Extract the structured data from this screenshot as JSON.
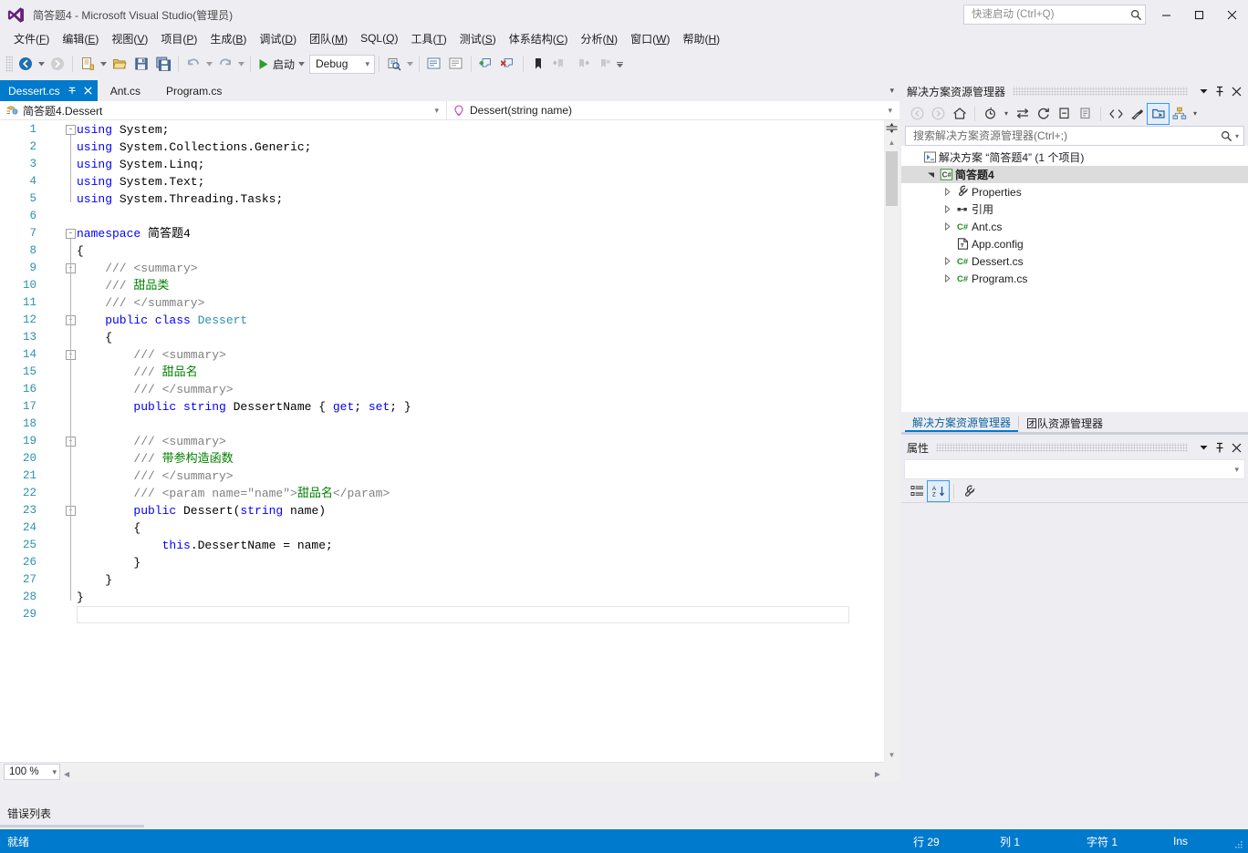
{
  "window": {
    "title": "简答题4 - Microsoft Visual Studio(管理员)",
    "logo_icon": "visual-studio-logo",
    "minimize_label": "–",
    "maximize_label": "❐",
    "close_label": "✕"
  },
  "quick_launch": {
    "placeholder": "快速启动 (Ctrl+Q)",
    "value": "",
    "icon": "search-icon"
  },
  "menu": {
    "items": [
      {
        "label": "文件",
        "key": "F"
      },
      {
        "label": "编辑",
        "key": "E"
      },
      {
        "label": "视图",
        "key": "V"
      },
      {
        "label": "项目",
        "key": "P"
      },
      {
        "label": "生成",
        "key": "B"
      },
      {
        "label": "调试",
        "key": "D"
      },
      {
        "label": "团队",
        "key": "M"
      },
      {
        "label": "SQL",
        "key": "Q"
      },
      {
        "label": "工具",
        "key": "T"
      },
      {
        "label": "测试",
        "key": "S"
      },
      {
        "label": "体系结构",
        "key": "C"
      },
      {
        "label": "分析",
        "key": "N"
      },
      {
        "label": "窗口",
        "key": "W"
      },
      {
        "label": "帮助",
        "key": "H"
      }
    ]
  },
  "toolbar": {
    "navigate_back_icon": "navigate-back-icon",
    "navigate_forward_icon": "navigate-forward-icon",
    "new_project_icon": "new-project-icon",
    "open_file_icon": "open-file-icon",
    "save_icon": "save-icon",
    "save_all_icon": "save-all-icon",
    "undo_icon": "undo-icon",
    "redo_icon": "redo-icon",
    "start_label": "启动",
    "start_icon": "play-icon",
    "config_value": "Debug",
    "find_icon": "find-in-files-icon",
    "comment_icon": "comment-icon",
    "uncomment_icon": "uncomment-icon",
    "outdent_icon": "outdent-icon",
    "indent_icon": "indent-icon",
    "bookmark_add_icon": "add-bookmark-icon",
    "bookmark_remove_icon": "remove-bookmark-icon",
    "bookmark_icon": "bookmark-icon",
    "prev_bookmark_icon": "previous-bookmark-icon",
    "next_bookmark_icon": "next-bookmark-icon",
    "clear_bookmarks_icon": "clear-bookmarks-icon",
    "overflow_icon": "toolbar-overflow-icon"
  },
  "doc_tabs": [
    {
      "label": "Dessert.cs",
      "active": true,
      "pin_icon": "pin-icon",
      "close_icon": "close-icon"
    },
    {
      "label": "Ant.cs",
      "active": false
    },
    {
      "label": "Program.cs",
      "active": false
    }
  ],
  "nav_bar": {
    "type_icon": "class-member-icon",
    "type_value": "简答题4.Dessert",
    "member_icon": "method-icon",
    "member_value": "Dessert(string name)"
  },
  "editor": {
    "zoom_level": "100 %",
    "caret_line": 29,
    "total_lines": 29,
    "lines": [
      {
        "n": 1,
        "fold": "-",
        "indent": 0,
        "tokens": [
          {
            "t": "using",
            "c": "kw"
          },
          {
            "t": " System;",
            "c": ""
          }
        ]
      },
      {
        "n": 2,
        "fold": "",
        "indent": 0,
        "tokens": [
          {
            "t": "using",
            "c": "kw"
          },
          {
            "t": " System.Collections.Generic;",
            "c": ""
          }
        ]
      },
      {
        "n": 3,
        "fold": "",
        "indent": 0,
        "tokens": [
          {
            "t": "using",
            "c": "kw"
          },
          {
            "t": " System.Linq;",
            "c": ""
          }
        ]
      },
      {
        "n": 4,
        "fold": "",
        "indent": 0,
        "tokens": [
          {
            "t": "using",
            "c": "kw"
          },
          {
            "t": " System.Text;",
            "c": ""
          }
        ]
      },
      {
        "n": 5,
        "fold": "",
        "indent": 0,
        "tokens": [
          {
            "t": "using",
            "c": "kw"
          },
          {
            "t": " System.Threading.Tasks;",
            "c": ""
          }
        ]
      },
      {
        "n": 6,
        "fold": "",
        "indent": 0,
        "tokens": []
      },
      {
        "n": 7,
        "fold": "-",
        "indent": 0,
        "tokens": [
          {
            "t": "namespace",
            "c": "kw"
          },
          {
            "t": " 简答题4",
            "c": ""
          }
        ]
      },
      {
        "n": 8,
        "fold": "",
        "indent": 0,
        "tokens": [
          {
            "t": "{",
            "c": ""
          }
        ]
      },
      {
        "n": 9,
        "fold": "-",
        "indent": 1,
        "tokens": [
          {
            "t": "/// <summary>",
            "c": "cmt"
          }
        ]
      },
      {
        "n": 10,
        "fold": "",
        "indent": 1,
        "tokens": [
          {
            "t": "/// ",
            "c": "cmt"
          },
          {
            "t": "甜品类",
            "c": "cmz"
          }
        ]
      },
      {
        "n": 11,
        "fold": "",
        "indent": 1,
        "tokens": [
          {
            "t": "/// </summary>",
            "c": "cmt"
          }
        ]
      },
      {
        "n": 12,
        "fold": "-",
        "indent": 1,
        "tokens": [
          {
            "t": "public class ",
            "c": "kw"
          },
          {
            "t": "Dessert",
            "c": "typ"
          }
        ]
      },
      {
        "n": 13,
        "fold": "",
        "indent": 1,
        "tokens": [
          {
            "t": "{",
            "c": ""
          }
        ]
      },
      {
        "n": 14,
        "fold": "-",
        "indent": 2,
        "tokens": [
          {
            "t": "/// <summary>",
            "c": "cmt"
          }
        ]
      },
      {
        "n": 15,
        "fold": "",
        "indent": 2,
        "tokens": [
          {
            "t": "/// ",
            "c": "cmt"
          },
          {
            "t": "甜品名",
            "c": "cmz"
          }
        ]
      },
      {
        "n": 16,
        "fold": "",
        "indent": 2,
        "tokens": [
          {
            "t": "/// </summary>",
            "c": "cmt"
          }
        ]
      },
      {
        "n": 17,
        "fold": "",
        "indent": 2,
        "tokens": [
          {
            "t": "public string",
            "c": "kw"
          },
          {
            "t": " DessertName { ",
            "c": ""
          },
          {
            "t": "get",
            "c": "kw"
          },
          {
            "t": "; ",
            "c": ""
          },
          {
            "t": "set",
            "c": "kw"
          },
          {
            "t": "; }",
            "c": ""
          }
        ]
      },
      {
        "n": 18,
        "fold": "",
        "indent": 2,
        "tokens": []
      },
      {
        "n": 19,
        "fold": "-",
        "indent": 2,
        "tokens": [
          {
            "t": "/// <summary>",
            "c": "cmt"
          }
        ]
      },
      {
        "n": 20,
        "fold": "",
        "indent": 2,
        "tokens": [
          {
            "t": "/// ",
            "c": "cmt"
          },
          {
            "t": "带参构造函数",
            "c": "cmz"
          }
        ]
      },
      {
        "n": 21,
        "fold": "",
        "indent": 2,
        "tokens": [
          {
            "t": "/// </summary>",
            "c": "cmt"
          }
        ]
      },
      {
        "n": 22,
        "fold": "",
        "indent": 2,
        "tokens": [
          {
            "t": "/// <param name=\"name\">",
            "c": "cmt"
          },
          {
            "t": "甜品名",
            "c": "cmz"
          },
          {
            "t": "</param>",
            "c": "cmt"
          }
        ]
      },
      {
        "n": 23,
        "fold": "-",
        "indent": 2,
        "tokens": [
          {
            "t": "public",
            "c": "kw"
          },
          {
            "t": " Dessert(",
            "c": ""
          },
          {
            "t": "string",
            "c": "kw"
          },
          {
            "t": " name)",
            "c": ""
          }
        ]
      },
      {
        "n": 24,
        "fold": "",
        "indent": 2,
        "tokens": [
          {
            "t": "{",
            "c": ""
          }
        ]
      },
      {
        "n": 25,
        "fold": "",
        "indent": 3,
        "tokens": [
          {
            "t": "this",
            "c": "kw"
          },
          {
            "t": ".DessertName = name;",
            "c": ""
          }
        ]
      },
      {
        "n": 26,
        "fold": "",
        "indent": 2,
        "tokens": [
          {
            "t": "}",
            "c": ""
          }
        ]
      },
      {
        "n": 27,
        "fold": "",
        "indent": 1,
        "tokens": [
          {
            "t": "}",
            "c": ""
          }
        ]
      },
      {
        "n": 28,
        "fold": "",
        "indent": 0,
        "tokens": [
          {
            "t": "}",
            "c": ""
          }
        ]
      },
      {
        "n": 29,
        "fold": "",
        "indent": 0,
        "tokens": []
      }
    ]
  },
  "error_list": {
    "tab_label": "错误列表"
  },
  "solution_explorer": {
    "title": "解决方案资源管理器",
    "dropdown_icon": "chevron-down-icon",
    "pin_icon": "pin-icon",
    "close_icon": "close-icon",
    "toolbar": {
      "back_icon": "navigate-back-icon",
      "forward_icon": "navigate-forward-icon",
      "home_icon": "home-icon",
      "pending_changes_icon": "pending-changes-filter-icon",
      "sync_icon": "sync-with-active-document-icon",
      "refresh_icon": "refresh-icon",
      "collapse_all_icon": "collapse-all-icon",
      "properties_window_icon": "properties-window-icon",
      "show_all_files_icon": "show-all-files-icon",
      "view_code_icon": "view-code-icon",
      "view_designer_icon": "view-designer-icon",
      "preview_selected_icon": "preview-selected-items-icon",
      "class_view_icon": "class-view-icon",
      "overflow_icon": "toolbar-overflow-icon"
    },
    "search": {
      "placeholder": "搜索解决方案资源管理器(Ctrl+;)",
      "value": "",
      "icon": "search-icon",
      "dropdown_icon": "chevron-down-icon"
    },
    "tree": [
      {
        "label": "解决方案 “简答题4” (1 个项目)",
        "icon": "solution-icon",
        "indent": 0,
        "expander": "",
        "bold": false,
        "selected": false
      },
      {
        "label": "简答题4",
        "icon": "csharp-project-icon",
        "indent": 1,
        "expander": "expanded",
        "bold": true,
        "selected": true
      },
      {
        "label": "Properties",
        "icon": "properties-folder-icon",
        "indent": 2,
        "expander": "collapsed",
        "bold": false,
        "selected": false
      },
      {
        "label": "引用",
        "icon": "references-icon",
        "indent": 2,
        "expander": "collapsed",
        "bold": false,
        "selected": false
      },
      {
        "label": "Ant.cs",
        "icon": "csharp-file-icon",
        "indent": 2,
        "expander": "collapsed",
        "bold": false,
        "selected": false
      },
      {
        "label": "App.config",
        "icon": "config-file-icon",
        "indent": 2,
        "expander": "",
        "bold": false,
        "selected": false
      },
      {
        "label": "Dessert.cs",
        "icon": "csharp-file-icon",
        "indent": 2,
        "expander": "collapsed",
        "bold": false,
        "selected": false
      },
      {
        "label": "Program.cs",
        "icon": "csharp-file-icon",
        "indent": 2,
        "expander": "collapsed",
        "bold": false,
        "selected": false
      }
    ],
    "bottom_tabs": [
      {
        "label": "解决方案资源管理器",
        "active": true
      },
      {
        "label": "团队资源管理器",
        "active": false
      }
    ]
  },
  "properties_panel": {
    "title": "属性",
    "dropdown_icon": "chevron-down-icon",
    "pin_icon": "pin-icon",
    "close_icon": "close-icon",
    "object_selector_value": "",
    "object_selector_icon": "chevron-down-icon",
    "toolbar": {
      "categorized_icon": "categorized-view-icon",
      "alphabetical_icon": "alphabetical-sort-icon",
      "properties_icon": "properties-wrench-icon"
    }
  },
  "status_bar": {
    "state": "就绪",
    "line_label": "行 29",
    "column_label": "列 1",
    "char_label": "字符 1",
    "insert_mode": "Ins",
    "grip_icon": "resize-grip-icon"
  },
  "colors": {
    "accent": "#007acc",
    "chrome": "#eeeef2",
    "editor_bg": "#ffffff",
    "keyword": "#0000ff",
    "type": "#2b91af",
    "comment": "#808080",
    "comment_text": "#008000",
    "line_number": "#2b91af"
  }
}
